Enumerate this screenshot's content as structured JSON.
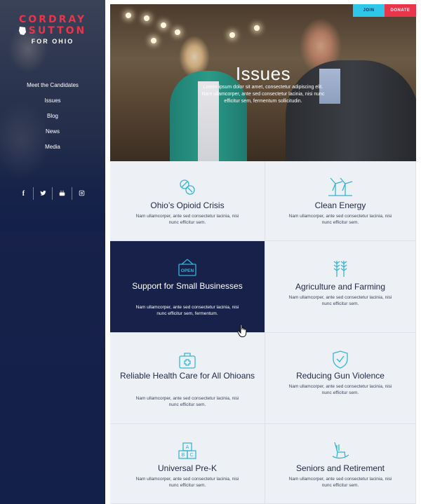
{
  "brand": {
    "line1": "CORDRAY",
    "line2": "SUTTON",
    "line3": "FOR OHIO",
    "accent_color": "#e8354a",
    "navy_color": "#17214a"
  },
  "nav": {
    "items": [
      {
        "label": "Meet the Candidates"
      },
      {
        "label": "Issues"
      },
      {
        "label": "Blog"
      },
      {
        "label": "News"
      },
      {
        "label": "Media"
      }
    ]
  },
  "social": {
    "items": [
      {
        "icon": "facebook-icon",
        "label": "f"
      },
      {
        "icon": "twitter-icon"
      },
      {
        "icon": "youtube-icon"
      },
      {
        "icon": "instagram-icon"
      }
    ]
  },
  "header": {
    "join_label": "JOIN",
    "donate_label": "DONATE",
    "join_color": "#2ec7ea"
  },
  "hero": {
    "title": "Issues",
    "text": "Lorem ipsum dolor sit amet, consectetur adipiscing elit. Nam ullamcorper, ante sed consectetur lacinia, nisi nunc efficitur sem, fermentum sollicitudin."
  },
  "issues": [
    {
      "icon": "pills-icon",
      "title": "Ohio’s Opioid Crisis",
      "desc": "Nam ullamcorper, ante sed consectetur lacinia, nisi nunc efficitur sem."
    },
    {
      "icon": "wind-turbine-icon",
      "title": "Clean Energy",
      "desc": "Nam ullamcorper, ante sed consectetur lacinia, nisi nunc efficitur sem."
    },
    {
      "icon": "open-sign-icon",
      "icon_text": "OPEN",
      "title": "Support for Small Businesses",
      "desc": "Nam ullamcorper, ante sed consectetur lacinia, nisi nunc efficitur sem, fermentum.",
      "active": true
    },
    {
      "icon": "wheat-icon",
      "title": "Agriculture and Farming",
      "desc": "Nam ullamcorper, ante sed consectetur lacinia, nisi nunc efficitur sem."
    },
    {
      "icon": "medical-kit-icon",
      "title": "Reliable Health Care for All Ohioans",
      "desc": "Nam ullamcorper, ante sed consectetur lacinia, nisi nunc efficitur sem."
    },
    {
      "icon": "shield-check-icon",
      "title": "Reducing Gun Violence",
      "desc": "Nam ullamcorper, ante sed consectetur lacinia, nisi nunc efficitur sem."
    },
    {
      "icon": "abc-blocks-icon",
      "title": "Universal Pre-K",
      "desc": "Nam ullamcorper, ante sed consectetur lacinia, nisi nunc efficitur sem.",
      "icon_letters": [
        "A",
        "B",
        "C"
      ]
    },
    {
      "icon": "rocking-chair-icon",
      "title": "Seniors and Retirement",
      "desc": "Nam ullamcorper, ante sed consectetur lacinia, nisi nunc efficitur sem."
    }
  ]
}
